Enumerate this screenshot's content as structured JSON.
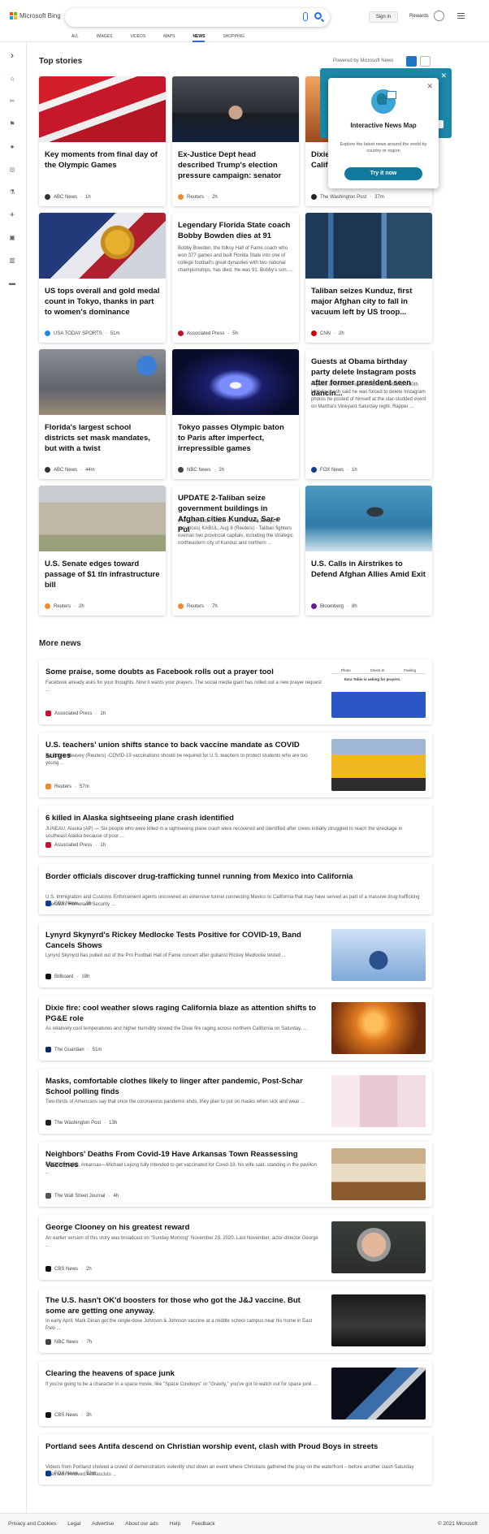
{
  "header": {
    "brand": "Microsoft Bing",
    "sign_in": "Sign in",
    "rewards": "Rewards"
  },
  "tabs": [
    {
      "label": "ALL"
    },
    {
      "label": "IMAGES"
    },
    {
      "label": "VIDEOS"
    },
    {
      "label": "MAPS"
    },
    {
      "label": "NEWS",
      "active": true
    },
    {
      "label": "SHOPPING"
    }
  ],
  "sidebar": [
    "expand-icon",
    "home-icon",
    "sports-icon",
    "flag-icon",
    "location-icon",
    "world-icon",
    "science-icon",
    "rocket-icon",
    "entertainment-icon",
    "business-icon",
    "money-icon"
  ],
  "top_stories": {
    "title": "Top stories",
    "powered": "Powered by Microsoft News"
  },
  "popup": {
    "title": "Interactive News Map",
    "desc": "Explore the latest news around the world by country or region",
    "button": "Try it now"
  },
  "cards": [
    {
      "title": "Key moments from final day of the Olympic Games",
      "summary": "",
      "source": "ABC News",
      "time": "1h",
      "img": "olympics"
    },
    {
      "title": "Ex-Justice Dept head described Trump's election pressure campaign: senator",
      "summary": "",
      "source": "Reuters",
      "time": "2h",
      "img": "trump"
    },
    {
      "title": "Dixie fire... second-largest in California...",
      "summary": "",
      "source": "The Washington Post",
      "time": "37m",
      "img": "fire"
    },
    {
      "title": "US tops overall and gold medal count in Tokyo, thanks in part to women's dominance",
      "summary": "",
      "source": "USA TODAY SPORTS",
      "time": "51m",
      "img": "medal"
    },
    {
      "title": "Legendary Florida State coach Bobby Bowden dies at 91",
      "summary": "Bobby Bowden, the folksy Hall of Fame coach who won 377 games and built Florida State into one of college football's great dynasties with two national championships, has died. He was 91. Bobby's son, ...",
      "source": "Associated Press",
      "time": "5h",
      "img": ""
    },
    {
      "title": "Taliban seizes Kunduz, first major Afghan city to fall in vacuum left by US troop...",
      "summary": "",
      "source": "CNN",
      "time": "2h",
      "img": "kunduz"
    },
    {
      "title": "Florida's largest school districts set mask mandates, but with a twist",
      "summary": "",
      "source": "ABC News",
      "time": "44m",
      "img": "school"
    },
    {
      "title": "Tokyo passes Olympic baton to Paris after imperfect, irrepressible games",
      "summary": "",
      "source": "NBC News",
      "time": "2h",
      "img": "stadium"
    },
    {
      "title": "Guests at Obama birthday party delete Instagram posts after former president seen dancin...",
      "summary": "A guest at former President Barack Obama's 60th birthday bash said he was forced to delete Instagram photos he posted of himself at the star-studded event on Martha's Vineyard Saturday night. Rapper ...",
      "source": "FOX News",
      "time": "1h",
      "img": ""
    },
    {
      "title": "U.S. Senate edges toward passage of $1 tln infrastructure bill",
      "summary": "",
      "source": "Reuters",
      "time": "2h",
      "img": "capitol"
    },
    {
      "title": "UPDATE 2-Taliban seize government buildings in Afghan cities Kunduz, Sar-e Pul",
      "summary": "(Recasts, adds details on Takhar and Jawzjan provinces) KABUL, Aug 8 (Reuters) - Taliban fighters overran two provincial capitals, including the strategic northeastern city of Kunduz and northern ...",
      "source": "Reuters",
      "time": "7h",
      "img": ""
    },
    {
      "title": "U.S. Calls in Airstrikes to Defend Afghan Allies Amid Exit",
      "summary": "",
      "source": "Bloomberg",
      "time": "8h",
      "img": "plane"
    }
  ],
  "more_news": {
    "title": "More news"
  },
  "rows": [
    {
      "title": "Some praise, some doubts as Facebook rolls out a prayer tool",
      "summary": "Facebook already asks for your thoughts. Now it wants your prayers. The social media giant has rolled out a new prayer request ...",
      "source": "Associated Press",
      "time": "1h",
      "img": "facebook",
      "fb_tabs": [
        "Photo",
        "Check In",
        "Feeling"
      ],
      "fb_post": "Ezra Tobin is asking for prayers."
    },
    {
      "title": "U.S. teachers' union shifts stance to back vaccine mandate as COVID surges",
      "summary": "By Susan Heavey (Reuters) -COVID-19 vaccinations should be required for U.S. teachers to protect students who are too young ...",
      "source": "Reuters",
      "time": "57m",
      "img": "bus"
    },
    {
      "title": "6 killed in Alaska sightseeing plane crash identified",
      "summary": "JUNEAU, Alaska (AP) — Six people who were killed in a sightseeing plane crash were recovered and identified after crews initially struggled to reach the wreckage in southeast Alaska because of poor ...",
      "source": "Associated Press",
      "time": "1h",
      "img": ""
    },
    {
      "title": "Border officials discover drug-trafficking tunnel running from Mexico into California",
      "summary": "U.S. Immigration and Customs Enforcement agents uncovered an extensive tunnel connecting Mexico to California that may have served as part of a massive drug trafficking operation.  Homeland Security ...",
      "source": "FOX News",
      "time": "3h",
      "img": ""
    },
    {
      "title": "Lynyrd Skynyrd's Rickey Medlocke Tests Positive for COVID-19, Band Cancels Shows",
      "summary": "Lynyrd Skynyrd has pulled out of the Pro Football Hall of Fame concert after guitarist Rickey Medlocke tested ...",
      "source": "Billboard",
      "time": "18h",
      "img": "band"
    },
    {
      "title": "Dixie fire: cool weather slows raging California blaze as attention shifts to PG&E role",
      "summary": "As relatively cool temperatures and higher humidity slowed the Dixie fire raging across northern California on Saturday, ...",
      "source": "The Guardian",
      "time": "51m",
      "img": "blaze"
    },
    {
      "title": "Masks, comfortable clothes likely to linger after pandemic, Post-Schar School polling finds",
      "summary": "Two-thirds of Americans say that once the coronavirus pandemic ends, they plan to put on masks when sick and wear ...",
      "source": "The Washington Post",
      "time": "13h",
      "img": "masks"
    },
    {
      "title": "Neighbors' Deaths From Covid-19 Have Arkansas Town Reassessing Vaccines",
      "summary": "GREENWOOD, Arkansas—Michael Lejong fully intended to get vaccinated for Covid-19, his wife said, standing in the pavilion ...",
      "source": "The Wall Street Journal",
      "time": "4h",
      "img": "arkansas"
    },
    {
      "title": "George Clooney on his greatest reward",
      "summary": "An earlier version of this story was broadcast on \"Sunday Morning\" November 29, 2020. Last November, actor-director George ...",
      "source": "CBS News",
      "time": "2h",
      "img": "clooney"
    },
    {
      "title": "The U.S. hasn't OK'd boosters for those who got the J&J vaccine. But some are getting one anyway.",
      "summary": "In early April, Mark Dinan got the single-dose Johnson & Johnson vaccine at a middle school campus near his home in East Palo ...",
      "source": "NBC News",
      "time": "7h",
      "img": "vaccine"
    },
    {
      "title": "Clearing the heavens of space junk",
      "summary": "If you're going to be a character in a space movie, like \"Space Cowboys\" or \"Gravity,\" you've got to watch out for space junk ...",
      "source": "CBS News",
      "time": "3h",
      "img": "space"
    },
    {
      "title": "Portland sees Antifa descend on Christian worship event, clash with Proud Boys in streets",
      "summary": "Videos from Portland showed a crowd of demonstrators violently shut down an event where Christians gathered the pray on the waterfront – before another clash Saturday afternoon involved Antifascists ...",
      "source": "FOX News",
      "time": "52m",
      "img": ""
    }
  ],
  "footer": {
    "links": [
      "Privacy and Cookies",
      "Legal",
      "Advertise",
      "About our ads",
      "Help",
      "Feedback"
    ],
    "copyright": "© 2021 Microsoft"
  },
  "colors": {
    "accent": "#1f74c7",
    "popup_button": "#117a9e"
  }
}
